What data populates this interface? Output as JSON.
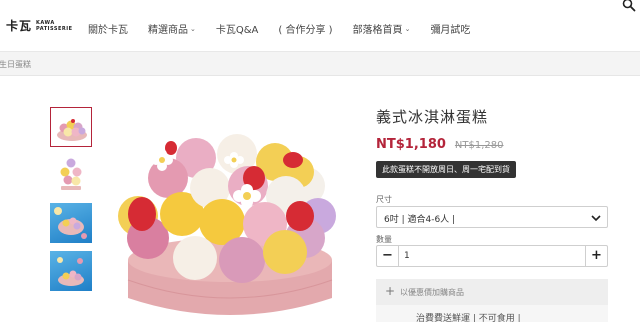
{
  "header": {
    "logo_main": "卡瓦",
    "logo_line1": "KAWA",
    "logo_line2": "PATISSERIE",
    "nav": [
      {
        "label": "關於卡瓦",
        "has_dropdown": false
      },
      {
        "label": "精選商品",
        "has_dropdown": true
      },
      {
        "label": "卡瓦Q&A",
        "has_dropdown": false
      },
      {
        "label": "( 合作分享 )",
        "has_dropdown": false
      },
      {
        "label": "部落格首頁",
        "has_dropdown": true
      },
      {
        "label": "彌月試吃",
        "has_dropdown": false
      }
    ],
    "search_icon": "search-icon"
  },
  "breadcrumb": {
    "text": "生日蛋糕"
  },
  "product": {
    "title": "義式冰淇淋蛋糕",
    "price": "NT$1,180",
    "original_price": "NT$1,280",
    "notice": "此款蛋糕不開放周日、周一宅配到貨",
    "size_label": "尺寸",
    "size_value": "6吋 | 適合4-6人 |",
    "qty_label": "數量",
    "qty_minus": "−",
    "qty_value": "1",
    "qty_plus": "+",
    "addon_plus": "+",
    "addon_text": "以優惠價加購商品",
    "addon_item": "治費費送鮮運 | 不可食用 |"
  },
  "colors": {
    "accent": "#b4243a",
    "badge_bg": "#333333"
  }
}
